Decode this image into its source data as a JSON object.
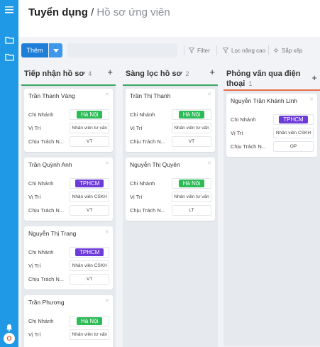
{
  "sidebar": {
    "menu_icon": "menu-icon",
    "nav_icons": [
      "folder-icon",
      "folder-icon"
    ],
    "bell_icon": "bell-icon",
    "avatar_letter": "O"
  },
  "breadcrumb": {
    "parent": "Tuyển dụng",
    "separator": "/",
    "current": "Hồ sơ ứng viên"
  },
  "toolbar": {
    "add_label": "Thêm",
    "filter_label": "Filter",
    "advanced_filter_label": "Lọc nâng cao",
    "sort_label": "Sắp xếp"
  },
  "field_labels": {
    "branch": "Chi Nhánh",
    "position": "Vị Trí",
    "owner": "Chịu Trách N..."
  },
  "colors": {
    "sidebar": "#1f98e5",
    "primary_button": "#1f7ed8",
    "hanoi_tag": "#2dbb58",
    "hcm_tag": "#6c3bd8",
    "column_green": "#3aa760",
    "column_orange": "#e86e47"
  },
  "columns": [
    {
      "title": "Tiếp nhận hồ sơ",
      "count": "4",
      "cards": [
        {
          "name": "Trần Thanh Vàng",
          "branch": "Hà Nội",
          "branch_type": "hn",
          "position": "Nhân viên tư vấn",
          "owner": "VT"
        },
        {
          "name": "Trần Quỳnh Anh",
          "branch": "TPHCM",
          "branch_type": "hcm",
          "position": "Nhân viên CSKH",
          "owner": "VT"
        },
        {
          "name": "Nguyễn Thị Trang",
          "branch": "TPHCM",
          "branch_type": "hcm",
          "position": "Nhân viên CSKH",
          "owner": "VT"
        },
        {
          "name": "Trần Phương",
          "branch": "Hà Nội",
          "branch_type": "hn",
          "position": "Nhân viên tư vấn",
          "owner": ""
        }
      ]
    },
    {
      "title": "Sàng lọc hồ sơ",
      "count": "2",
      "cards": [
        {
          "name": "Trần Thị Thanh",
          "branch": "Hà Nội",
          "branch_type": "hn",
          "position": "Nhân viên tư vấn",
          "owner": "VT"
        },
        {
          "name": "Nguyễn Thị Quyên",
          "branch": "Hà Nội",
          "branch_type": "hn",
          "position": "Nhân viên tư vấn",
          "owner": "LT"
        }
      ]
    },
    {
      "title": "Phỏng vấn qua điện thoại",
      "count": "1",
      "cards": [
        {
          "name": "Nguyễn Trần Khánh Linh",
          "branch": "TPHCM",
          "branch_type": "hcm",
          "position": "Nhân viên CSKH",
          "owner": "OP"
        }
      ]
    }
  ]
}
